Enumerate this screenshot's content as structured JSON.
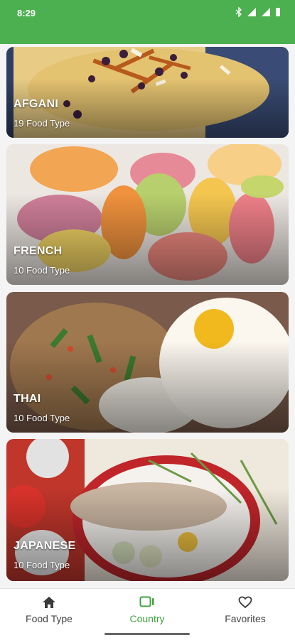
{
  "status_bar": {
    "time": "8:29"
  },
  "countries": [
    {
      "name": "AFGANI",
      "count": "19 Food Type"
    },
    {
      "name": "FRENCH",
      "count": "10 Food Type"
    },
    {
      "name": "THAI",
      "count": "10 Food Type"
    },
    {
      "name": "JAPANESE",
      "count": "10 Food Type"
    }
  ],
  "bottom_nav": {
    "items": [
      {
        "label": "Food Type",
        "icon": "home-icon"
      },
      {
        "label": "Country",
        "icon": "country-icon",
        "active": true
      },
      {
        "label": "Favorites",
        "icon": "heart-icon"
      }
    ]
  },
  "colors": {
    "accent": "#4caf50",
    "active": "#3ea341"
  }
}
